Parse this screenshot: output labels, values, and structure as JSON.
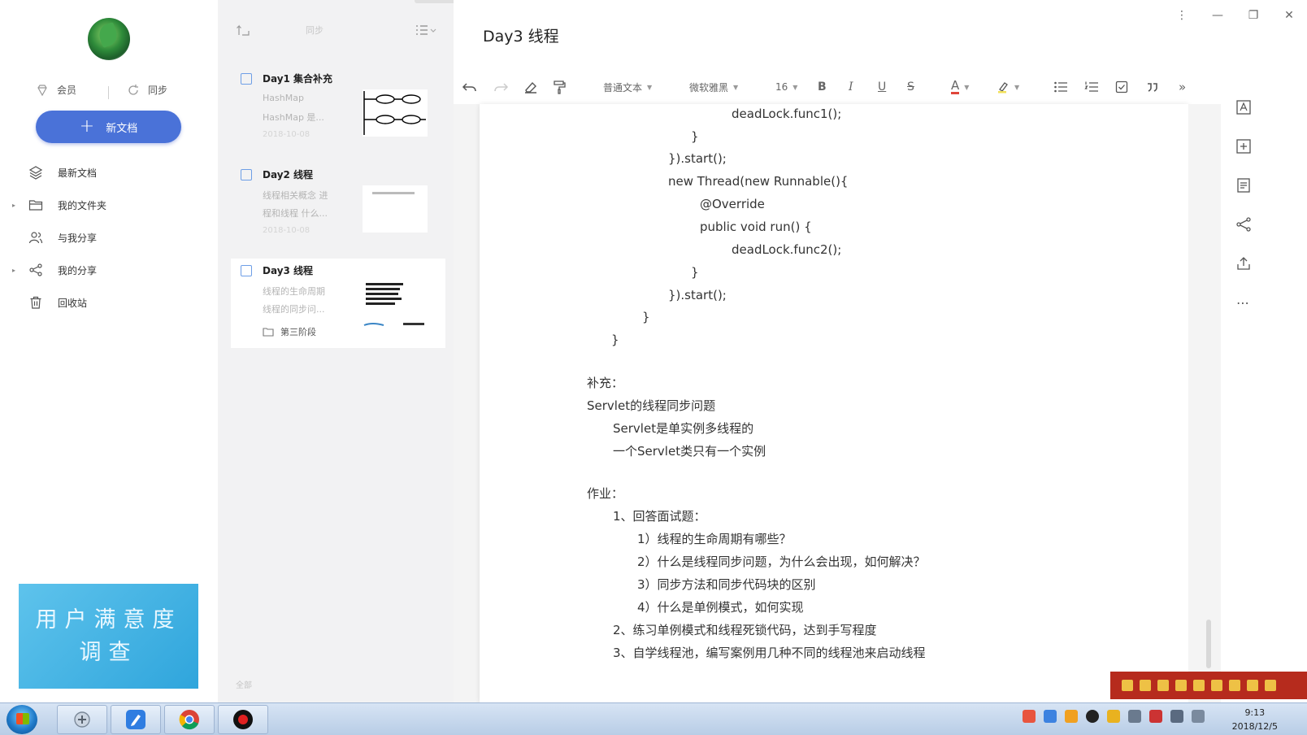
{
  "sidebar": {
    "member_label": "会员",
    "sync_label": "同步",
    "new_doc_label": "新文档",
    "nav": [
      {
        "label": "最新文档",
        "icon": "layers-icon",
        "caret": false
      },
      {
        "label": "我的文件夹",
        "icon": "folder-icon",
        "caret": true
      },
      {
        "label": "与我分享",
        "icon": "people-icon",
        "caret": false
      },
      {
        "label": "我的分享",
        "icon": "share-icon",
        "caret": true
      },
      {
        "label": "回收站",
        "icon": "trash-icon",
        "caret": false
      }
    ],
    "survey_line1": "用户满意度",
    "survey_line2": "调查"
  },
  "list": {
    "sync_text": "同步",
    "cards": [
      {
        "title": "Day1 集合补充",
        "snippet1": "HashMap",
        "snippet2": "HashMap 是...",
        "date": "2018-10-08"
      },
      {
        "title": "Day2 线程",
        "snippet1": "线程相关概念 进",
        "snippet2": "程和线程 什么...",
        "date": "2018-10-08"
      },
      {
        "title": "Day3 线程",
        "snippet1": "线程的生命周期",
        "snippet2": "线程的同步问...",
        "folder": "第三阶段"
      }
    ],
    "footer": "全部"
  },
  "editor": {
    "title": "Day3 线程",
    "toolbar": {
      "paragraph_style": "普通文本",
      "font_family": "微软雅黑",
      "font_size": "16",
      "bold": "B",
      "italic": "I",
      "underline": "U",
      "strike": "S",
      "font_color": "A",
      "more": "»"
    },
    "content": {
      "code": [
        "deadLock.func1();",
        "}",
        "}).start();",
        "new Thread(new Runnable(){",
        "@Override",
        "public void run() {",
        "deadLock.func2();",
        "}",
        "}).start();",
        "}",
        "}"
      ],
      "supplement_heading": "补充：",
      "supplement": [
        "Servlet的线程同步问题",
        "Servlet是单实例多线程的",
        "一个Servlet类只有一个实例"
      ],
      "homework_heading": "作业：",
      "homework": [
        "1、回答面试题：",
        "1）线程的生命周期有哪些？",
        "2）什么是线程同步问题，为什么会出现，如何解决？",
        "3）同步方法和同步代码块的区别",
        "4）什么是单例模式，如何实现",
        "2、练习单例模式和线程死锁代码，达到手写程度",
        "3、自学线程池，编写案例用几种不同的线程池来启动线程"
      ]
    }
  },
  "taskbar": {
    "time": "9:13",
    "date": "2018/12/5"
  },
  "colors": {
    "accent": "#4a72d8",
    "survey": "#3fb0e2",
    "ime": "#b62b1d"
  }
}
